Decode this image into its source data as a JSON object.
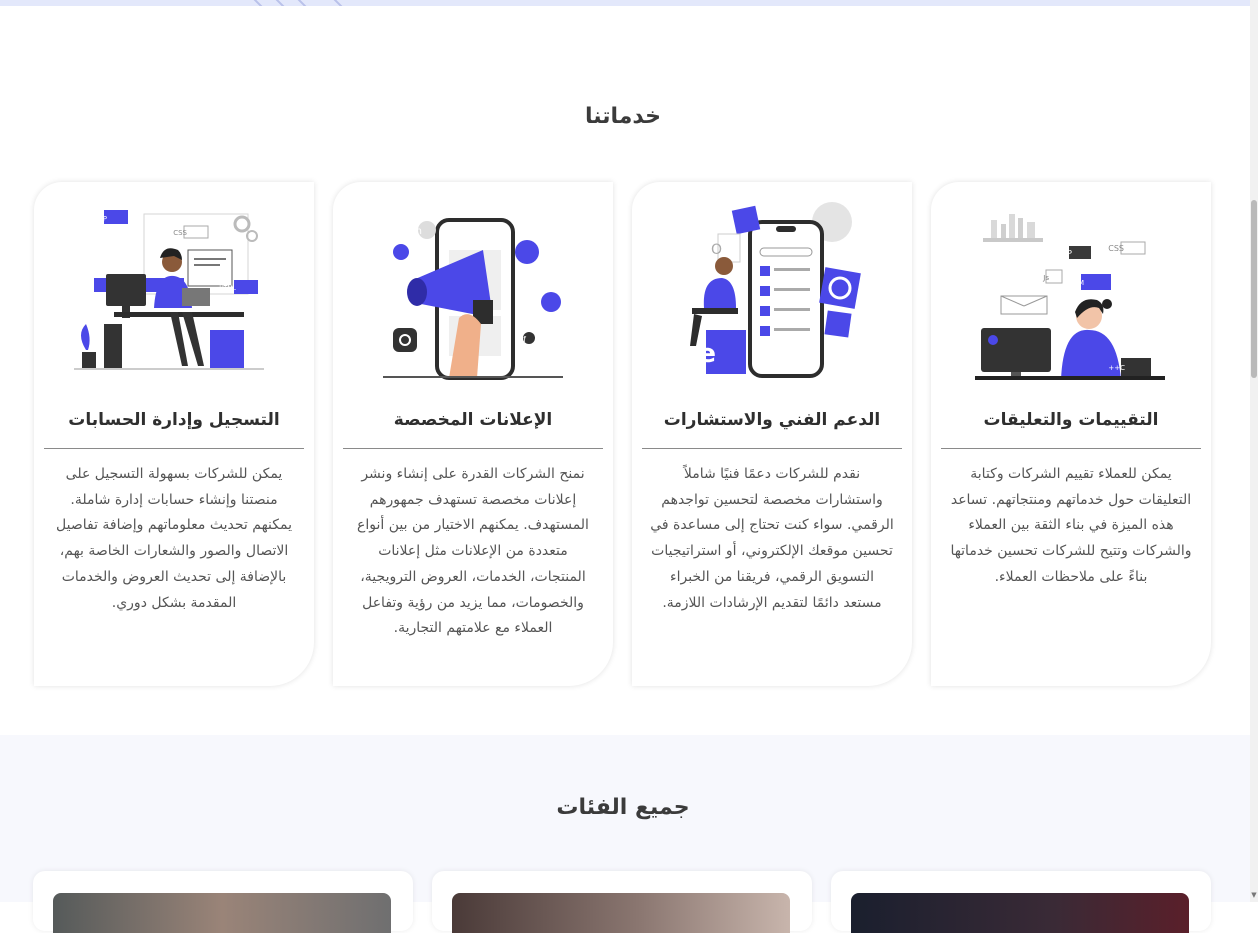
{
  "services": {
    "title": "خدماتنا",
    "cards": [
      {
        "title": "التقييمات والتعليقات",
        "text": "يمكن للعملاء تقييم الشركات وكتابة التعليقات حول خدماتهم ومنتجاتهم. تساعد هذه الميزة في بناء الثقة بين العملاء والشركات وتتيح للشركات تحسين خدماتها بناءً على ملاحظات العملاء.",
        "illustration": "customer-reviews-illustration",
        "labels": {
          "php": "PHP",
          "css": "CSS",
          "htlm": "HTLM",
          "js": "Js",
          "cpp": "C++"
        }
      },
      {
        "title": "الدعم الفني والاستشارات",
        "text": "نقدم للشركات دعمًا فنيًا شاملاً واستشارات مخصصة لتحسين تواجدهم الرقمي. سواء كنت تحتاج إلى مساعدة في تحسين موقعك الإلكتروني، أو استراتيجيات التسويق الرقمي، فريقنا من الخبراء مستعد دائمًا لتقديم الإرشادات اللازمة.",
        "illustration": "technical-support-illustration",
        "labels": {
          "e": "e",
          "o": "O"
        }
      },
      {
        "title": "الإعلانات المخصصة",
        "text": "نمنح الشركات القدرة على إنشاء ونشر إعلانات مخصصة تستهدف جمهورهم المستهدف. يمكنهم الاختيار من بين أنواع متعددة من الإعلانات مثل إعلانات المنتجات، الخدمات، العروض الترويجية، والخصومات، مما يزيد من رؤية وتفاعل العملاء مع علامتهم التجارية.",
        "illustration": "custom-ads-illustration",
        "labels": {
          "in": "in",
          "f": "f"
        }
      },
      {
        "title": "التسجيل وإدارة الحسابات",
        "text": "يمكن للشركات بسهولة التسجيل على منصتنا وإنشاء حسابات إدارة شاملة. يمكنهم تحديث معلوماتهم وإضافة تفاصيل الاتصال والصور والشعارات الخاصة بهم، بالإضافة إلى تحديث العروض والخدمات المقدمة بشكل دوري.",
        "illustration": "account-management-illustration",
        "labels": {
          "php": "PHP",
          "css": "CSS",
          "html": "HTML"
        }
      }
    ]
  },
  "categories": {
    "title": "جميع الفئات",
    "cards": [
      {
        "image": "category-image-1"
      },
      {
        "image": "category-image-2"
      },
      {
        "image": "category-image-3"
      }
    ]
  },
  "colors": {
    "accent": "#4b48e8",
    "title_text": "#3b3b3b",
    "body_text": "#555555",
    "section_bg": "#f7f8fd"
  }
}
